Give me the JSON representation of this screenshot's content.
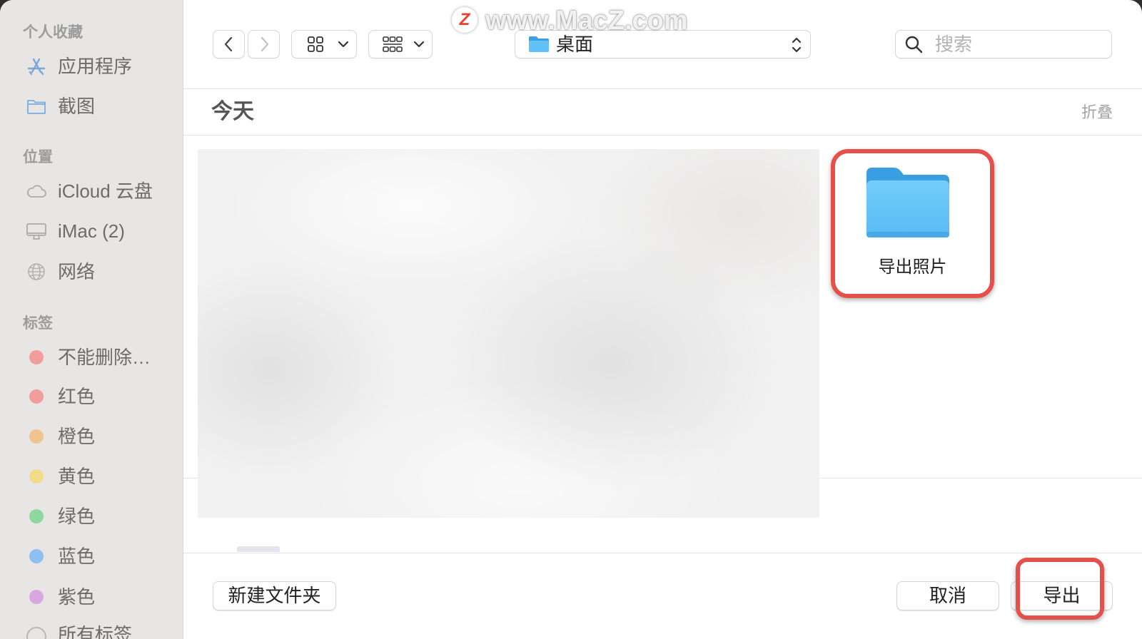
{
  "watermark": {
    "logo_letter": "Z",
    "text": "www.MacZ.com"
  },
  "sidebar": {
    "sections": [
      {
        "title": "个人收藏",
        "items": [
          {
            "label": "应用程序",
            "icon": "app-store-icon"
          },
          {
            "label": "截图",
            "icon": "folder-icon"
          }
        ]
      },
      {
        "title": "位置",
        "items": [
          {
            "label": "iCloud 云盘",
            "icon": "cloud-icon"
          },
          {
            "label": "iMac (2)",
            "icon": "monitor-icon"
          },
          {
            "label": "网络",
            "icon": "globe-icon"
          }
        ]
      },
      {
        "title": "标签",
        "items": [
          {
            "label": "不能删除…",
            "color": "#f29c9c"
          },
          {
            "label": "红色",
            "color": "#f29c9c"
          },
          {
            "label": "橙色",
            "color": "#f1c38f"
          },
          {
            "label": "黄色",
            "color": "#f3db87"
          },
          {
            "label": "绿色",
            "color": "#8fd89d"
          },
          {
            "label": "蓝色",
            "color": "#8fbef0"
          },
          {
            "label": "紫色",
            "color": "#d8a7e2"
          },
          {
            "label": "所有标签",
            "icon": "all-tags-icon"
          }
        ]
      }
    ]
  },
  "toolbar": {
    "back_icon": "chevron-left-icon",
    "forward_icon": "chevron-right-icon",
    "view_icon": "grid-view-icon",
    "group_icon": "group-view-icon",
    "location": "桌面",
    "location_icon": "folder-icon",
    "search_placeholder": "搜索"
  },
  "content": {
    "group_title": "今天",
    "collapse_label": "折叠",
    "items": [
      {
        "name": "导出照片",
        "type": "folder"
      }
    ]
  },
  "footer": {
    "new_folder_label": "新建文件夹",
    "cancel_label": "取消",
    "export_label": "导出"
  },
  "colors": {
    "sidebar_bg": "#e8e6e5",
    "sidebar_icon_blue": "#7aa6dc",
    "folder_blue": "#5bbff5",
    "highlight_red": "#e4504a"
  }
}
